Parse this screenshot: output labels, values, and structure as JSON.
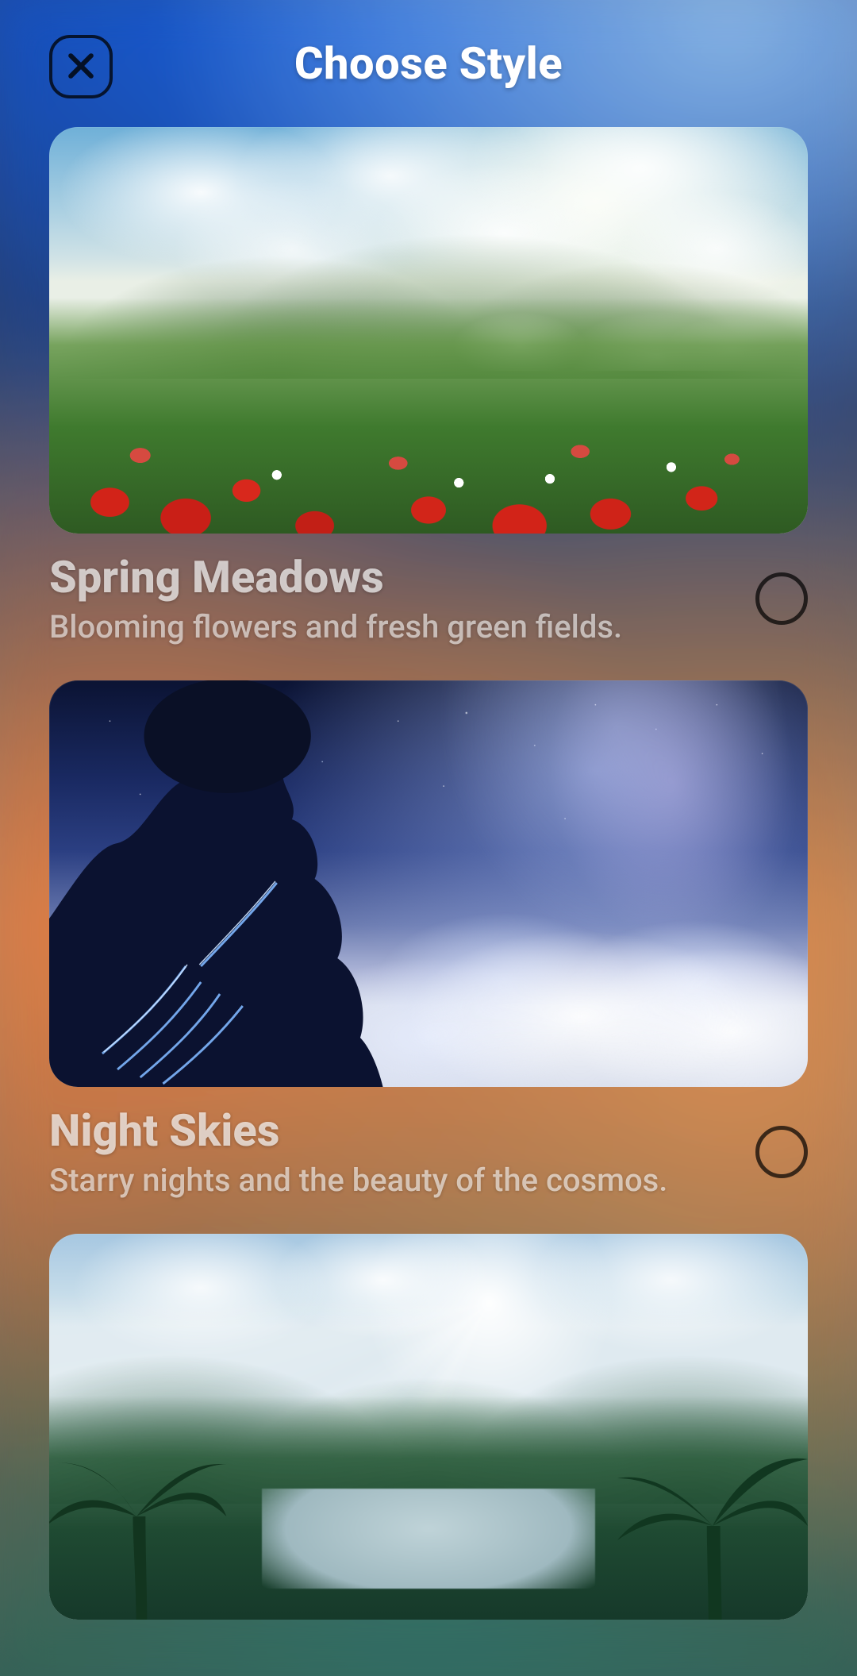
{
  "header": {
    "title": "Choose Style"
  },
  "styles": [
    {
      "id": "spring-meadows",
      "title": "Spring Meadows",
      "description": "Blooming flowers and fresh green fields.",
      "selected": false
    },
    {
      "id": "night-skies",
      "title": "Night Skies",
      "description": "Starry nights and the beauty of the cosmos.",
      "selected": false
    },
    {
      "id": "tropical-valley",
      "title": "",
      "description": "",
      "selected": false,
      "partial": true
    }
  ]
}
